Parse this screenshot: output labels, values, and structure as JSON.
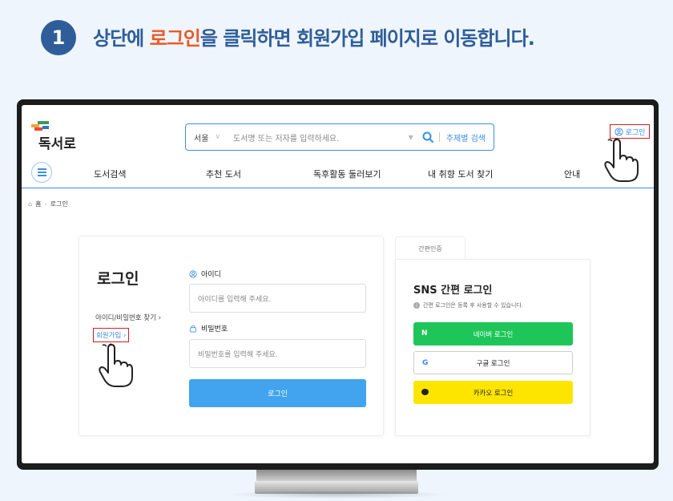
{
  "instruction": {
    "step_number": "1",
    "text_before": "상단에 ",
    "text_highlight": "로그인",
    "text_after": "을 클릭하면 회원가입 페이지로 이동합니다."
  },
  "site": {
    "logo_text": "독서로",
    "search": {
      "region": "서울",
      "placeholder": "도서명 또는 저자를 입력하세요.",
      "topic_search_label": "주제별 검색"
    },
    "header_login_label": "로그인",
    "nav_items": [
      "도서검색",
      "추천 도서",
      "독후활동 둘러보기",
      "내 취향 도서 찾기",
      "안내"
    ],
    "breadcrumb": {
      "home": "홈",
      "current": "로그인"
    }
  },
  "login_card": {
    "title": "로그인",
    "find_id_pw": "아이디/비밀번호 찾기",
    "signup_link": "회원가입",
    "id_label": "아이디",
    "id_placeholder": "아이디를 입력해 주세요.",
    "pw_label": "비밀번호",
    "pw_placeholder": "비밀번호를 입력해 주세요.",
    "submit_label": "로그인"
  },
  "sns_card": {
    "tab_label": "간편인증",
    "title": "SNS 간편 로그인",
    "info": "간편 로그인은 등록 후 사용할 수 있습니다.",
    "buttons": [
      {
        "icon": "N",
        "label": "네이버 로그인",
        "color": "#1ec65a"
      },
      {
        "icon": "G",
        "label": "구글 로그인",
        "color": "#ffffff"
      },
      {
        "icon": "kakao-bubble-icon",
        "label": "카카오 로그인",
        "color": "#fee500"
      }
    ]
  },
  "colors": {
    "brand_blue": "#2f5d9a",
    "highlight_orange": "#ea5a27",
    "accent_blue": "#3a8ee6",
    "annotation_red": "#d21f1f"
  }
}
